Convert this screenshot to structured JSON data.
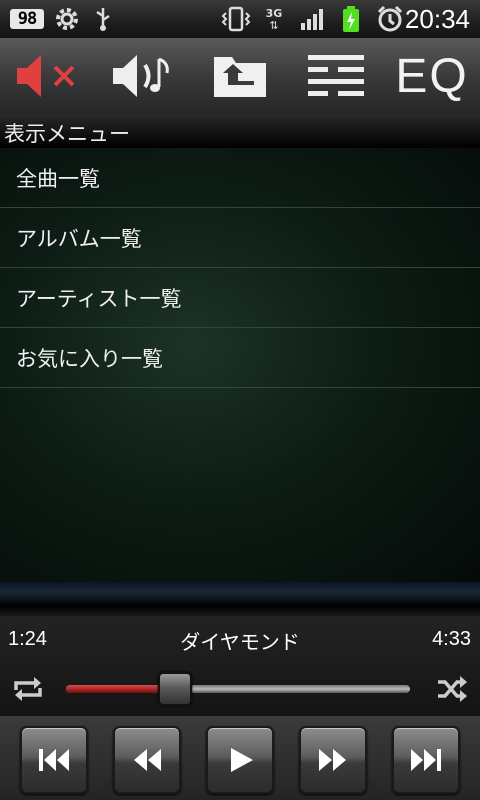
{
  "status_bar": {
    "battery_badge": "98",
    "network_label": "3G",
    "time": "20:34"
  },
  "toolbar": {
    "eq_label": "EQ"
  },
  "menu": {
    "title": "表示メニュー",
    "items": [
      {
        "label": "全曲一覧"
      },
      {
        "label": "アルバム一覧"
      },
      {
        "label": "アーティスト一覧"
      },
      {
        "label": "お気に入り一覧"
      }
    ]
  },
  "player": {
    "elapsed": "1:24",
    "song_title": "ダイヤモンド",
    "duration": "4:33",
    "progress_fraction": 0.31
  },
  "colors": {
    "accent_red": "#b82020",
    "battery_green": "#55dd22",
    "mute_red": "#e14040"
  },
  "icons": {
    "status": [
      "battery-badge-icon",
      "settings-icon",
      "usb-icon",
      "vibrate-icon",
      "network-3g-icon",
      "signal-icon",
      "battery-charging-icon",
      "alarm-icon"
    ],
    "toolbar": [
      "mute-icon",
      "volume-icon",
      "folder-up-icon",
      "playlist-icon"
    ],
    "player": [
      "repeat-icon",
      "shuffle-icon"
    ],
    "controls": [
      "skip-previous-icon",
      "rewind-icon",
      "play-icon",
      "fast-forward-icon",
      "skip-next-icon"
    ]
  }
}
